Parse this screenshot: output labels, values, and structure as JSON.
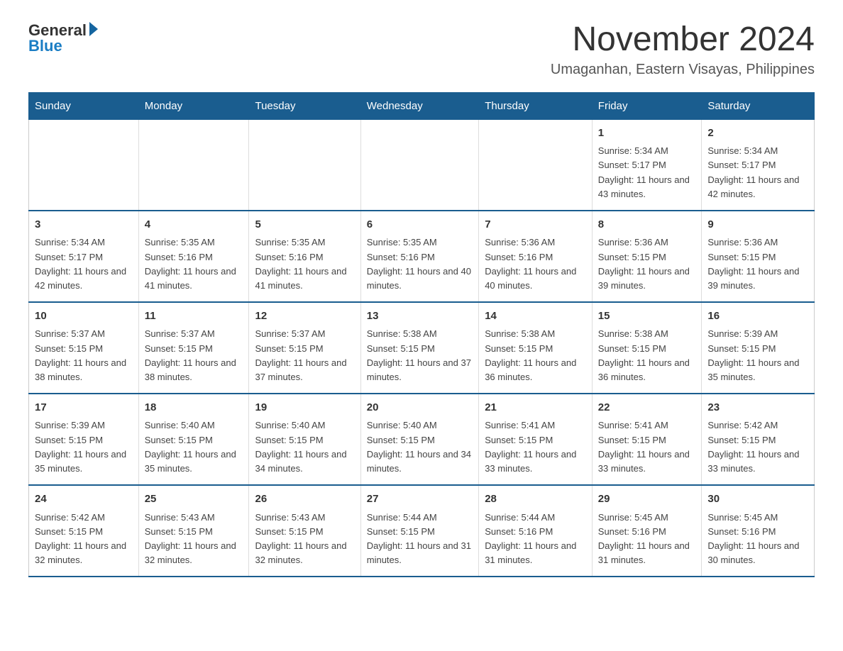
{
  "logo": {
    "general": "General",
    "blue": "Blue"
  },
  "title": "November 2024",
  "subtitle": "Umaganhan, Eastern Visayas, Philippines",
  "days_of_week": [
    "Sunday",
    "Monday",
    "Tuesday",
    "Wednesday",
    "Thursday",
    "Friday",
    "Saturday"
  ],
  "weeks": [
    [
      {
        "day": "",
        "info": ""
      },
      {
        "day": "",
        "info": ""
      },
      {
        "day": "",
        "info": ""
      },
      {
        "day": "",
        "info": ""
      },
      {
        "day": "",
        "info": ""
      },
      {
        "day": "1",
        "info": "Sunrise: 5:34 AM\nSunset: 5:17 PM\nDaylight: 11 hours and 43 minutes."
      },
      {
        "day": "2",
        "info": "Sunrise: 5:34 AM\nSunset: 5:17 PM\nDaylight: 11 hours and 42 minutes."
      }
    ],
    [
      {
        "day": "3",
        "info": "Sunrise: 5:34 AM\nSunset: 5:17 PM\nDaylight: 11 hours and 42 minutes."
      },
      {
        "day": "4",
        "info": "Sunrise: 5:35 AM\nSunset: 5:16 PM\nDaylight: 11 hours and 41 minutes."
      },
      {
        "day": "5",
        "info": "Sunrise: 5:35 AM\nSunset: 5:16 PM\nDaylight: 11 hours and 41 minutes."
      },
      {
        "day": "6",
        "info": "Sunrise: 5:35 AM\nSunset: 5:16 PM\nDaylight: 11 hours and 40 minutes."
      },
      {
        "day": "7",
        "info": "Sunrise: 5:36 AM\nSunset: 5:16 PM\nDaylight: 11 hours and 40 minutes."
      },
      {
        "day": "8",
        "info": "Sunrise: 5:36 AM\nSunset: 5:15 PM\nDaylight: 11 hours and 39 minutes."
      },
      {
        "day": "9",
        "info": "Sunrise: 5:36 AM\nSunset: 5:15 PM\nDaylight: 11 hours and 39 minutes."
      }
    ],
    [
      {
        "day": "10",
        "info": "Sunrise: 5:37 AM\nSunset: 5:15 PM\nDaylight: 11 hours and 38 minutes."
      },
      {
        "day": "11",
        "info": "Sunrise: 5:37 AM\nSunset: 5:15 PM\nDaylight: 11 hours and 38 minutes."
      },
      {
        "day": "12",
        "info": "Sunrise: 5:37 AM\nSunset: 5:15 PM\nDaylight: 11 hours and 37 minutes."
      },
      {
        "day": "13",
        "info": "Sunrise: 5:38 AM\nSunset: 5:15 PM\nDaylight: 11 hours and 37 minutes."
      },
      {
        "day": "14",
        "info": "Sunrise: 5:38 AM\nSunset: 5:15 PM\nDaylight: 11 hours and 36 minutes."
      },
      {
        "day": "15",
        "info": "Sunrise: 5:38 AM\nSunset: 5:15 PM\nDaylight: 11 hours and 36 minutes."
      },
      {
        "day": "16",
        "info": "Sunrise: 5:39 AM\nSunset: 5:15 PM\nDaylight: 11 hours and 35 minutes."
      }
    ],
    [
      {
        "day": "17",
        "info": "Sunrise: 5:39 AM\nSunset: 5:15 PM\nDaylight: 11 hours and 35 minutes."
      },
      {
        "day": "18",
        "info": "Sunrise: 5:40 AM\nSunset: 5:15 PM\nDaylight: 11 hours and 35 minutes."
      },
      {
        "day": "19",
        "info": "Sunrise: 5:40 AM\nSunset: 5:15 PM\nDaylight: 11 hours and 34 minutes."
      },
      {
        "day": "20",
        "info": "Sunrise: 5:40 AM\nSunset: 5:15 PM\nDaylight: 11 hours and 34 minutes."
      },
      {
        "day": "21",
        "info": "Sunrise: 5:41 AM\nSunset: 5:15 PM\nDaylight: 11 hours and 33 minutes."
      },
      {
        "day": "22",
        "info": "Sunrise: 5:41 AM\nSunset: 5:15 PM\nDaylight: 11 hours and 33 minutes."
      },
      {
        "day": "23",
        "info": "Sunrise: 5:42 AM\nSunset: 5:15 PM\nDaylight: 11 hours and 33 minutes."
      }
    ],
    [
      {
        "day": "24",
        "info": "Sunrise: 5:42 AM\nSunset: 5:15 PM\nDaylight: 11 hours and 32 minutes."
      },
      {
        "day": "25",
        "info": "Sunrise: 5:43 AM\nSunset: 5:15 PM\nDaylight: 11 hours and 32 minutes."
      },
      {
        "day": "26",
        "info": "Sunrise: 5:43 AM\nSunset: 5:15 PM\nDaylight: 11 hours and 32 minutes."
      },
      {
        "day": "27",
        "info": "Sunrise: 5:44 AM\nSunset: 5:15 PM\nDaylight: 11 hours and 31 minutes."
      },
      {
        "day": "28",
        "info": "Sunrise: 5:44 AM\nSunset: 5:16 PM\nDaylight: 11 hours and 31 minutes."
      },
      {
        "day": "29",
        "info": "Sunrise: 5:45 AM\nSunset: 5:16 PM\nDaylight: 11 hours and 31 minutes."
      },
      {
        "day": "30",
        "info": "Sunrise: 5:45 AM\nSunset: 5:16 PM\nDaylight: 11 hours and 30 minutes."
      }
    ]
  ]
}
